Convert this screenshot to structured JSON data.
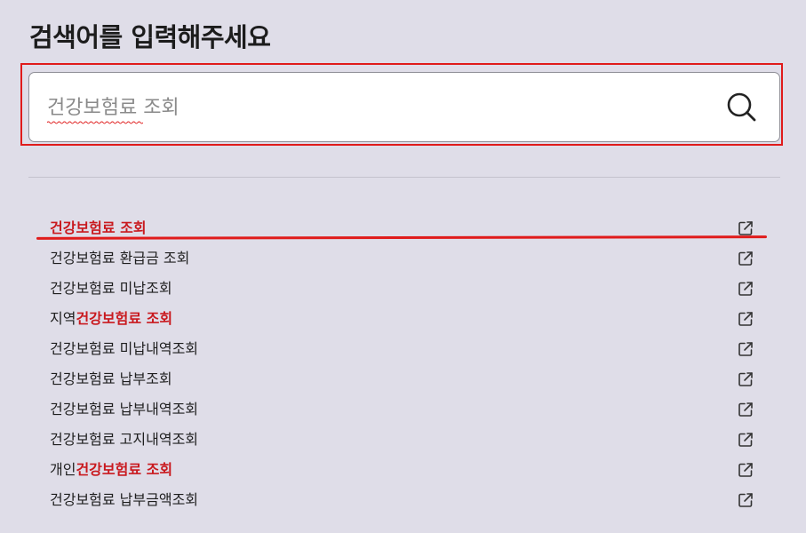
{
  "header": {
    "title": "검색어를 입력해주세요"
  },
  "search": {
    "placeholder": "건강보험료 조회",
    "icon": "search-icon"
  },
  "results": [
    {
      "prefix": "",
      "highlight": "건강보험료 조회",
      "suffix": "",
      "icon": "external-link-icon"
    },
    {
      "prefix": "건강보험료 환급금 조회",
      "highlight": "",
      "suffix": "",
      "icon": "external-link-icon"
    },
    {
      "prefix": "건강보험료 미납조회",
      "highlight": "",
      "suffix": "",
      "icon": "external-link-icon"
    },
    {
      "prefix": "지역",
      "highlight": "건강보험료 조회",
      "suffix": "",
      "icon": "external-link-icon"
    },
    {
      "prefix": "건강보험료 미납내역조회",
      "highlight": "",
      "suffix": "",
      "icon": "external-link-icon"
    },
    {
      "prefix": "건강보험료 납부조회",
      "highlight": "",
      "suffix": "",
      "icon": "external-link-icon"
    },
    {
      "prefix": "건강보험료 납부내역조회",
      "highlight": "",
      "suffix": "",
      "icon": "external-link-icon"
    },
    {
      "prefix": "건강보험료 고지내역조회",
      "highlight": "",
      "suffix": "",
      "icon": "external-link-icon"
    },
    {
      "prefix": "개인",
      "highlight": "건강보험료 조회",
      "suffix": "",
      "icon": "external-link-icon"
    },
    {
      "prefix": "건강보험료 납부금액조회",
      "highlight": "",
      "suffix": "",
      "icon": "external-link-icon"
    }
  ],
  "colors": {
    "background": "#dfdde8",
    "highlight_text": "#c9191e",
    "annotation_red": "#e01b1b"
  }
}
